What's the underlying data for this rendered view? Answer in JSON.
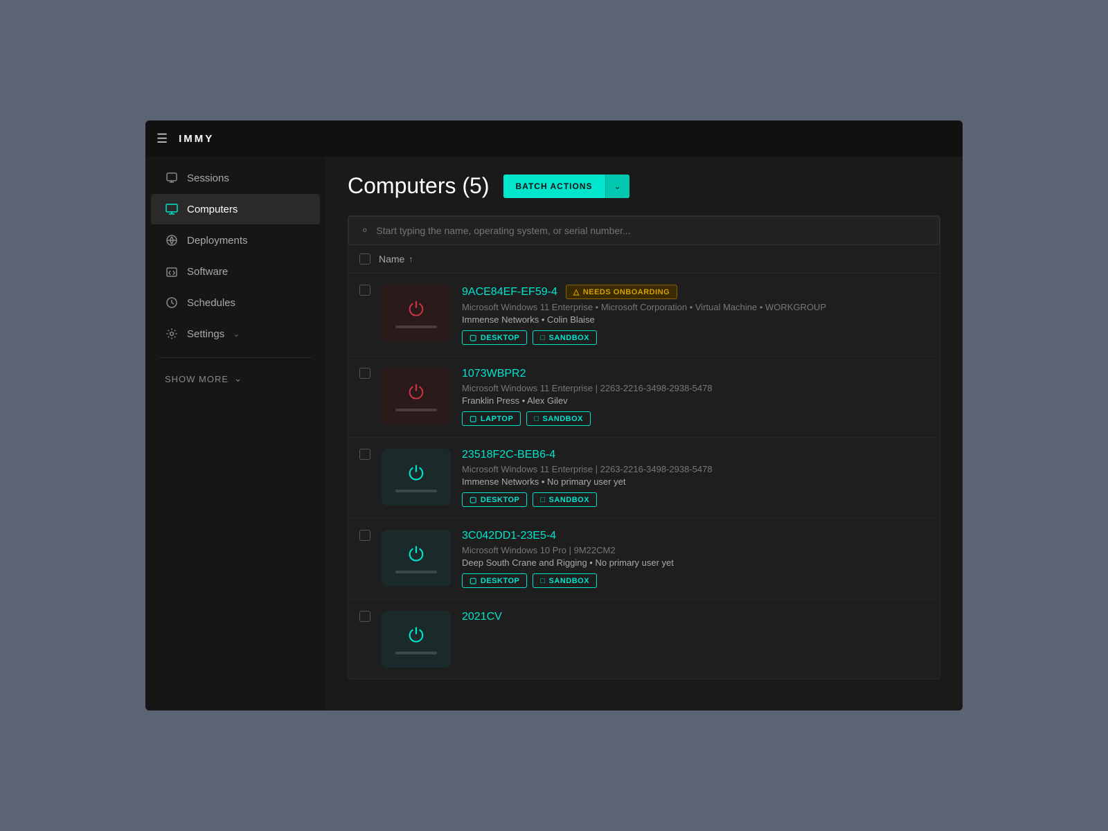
{
  "topbar": {
    "logo": "IMMY"
  },
  "sidebar": {
    "items": [
      {
        "id": "sessions",
        "label": "Sessions",
        "icon": "sessions-icon",
        "active": false
      },
      {
        "id": "computers",
        "label": "Computers",
        "icon": "computers-icon",
        "active": true
      },
      {
        "id": "deployments",
        "label": "Deployments",
        "icon": "deployments-icon",
        "active": false
      },
      {
        "id": "software",
        "label": "Software",
        "icon": "software-icon",
        "active": false
      },
      {
        "id": "schedules",
        "label": "Schedules",
        "icon": "schedules-icon",
        "active": false
      },
      {
        "id": "settings",
        "label": "Settings",
        "icon": "settings-icon",
        "active": false
      }
    ],
    "show_more": "SHOW MORE"
  },
  "page": {
    "title": "Computers (5)",
    "batch_actions_label": "BATCH ACTIONS",
    "search_placeholder": "Start typing the name, operating system, or serial number...",
    "table_header_name": "Name",
    "computers": [
      {
        "id": "comp-1",
        "name": "9ACE84EF-EF59-4",
        "badge": "NEEDS ONBOARDING",
        "meta": "Microsoft Windows 11 Enterprise  •  Microsoft Corporation  •  Virtual Machine  •  WORKGROUP",
        "user_info": "Immense Networks  •  Colin Blaise",
        "tags": [
          "DESKTOP",
          "SANDBOX"
        ],
        "power_color": "red",
        "bg": "red"
      },
      {
        "id": "comp-2",
        "name": "1073WBPR2",
        "badge": null,
        "meta": "Microsoft Windows 11 Enterprise | 2263-2216-3498-2938-5478",
        "user_info": "Franklin Press  •  Alex Gilev",
        "tags": [
          "LAPTOP",
          "SANDBOX"
        ],
        "power_color": "red",
        "bg": "red"
      },
      {
        "id": "comp-3",
        "name": "23518F2C-BEB6-4",
        "badge": null,
        "meta": "Microsoft Windows 11 Enterprise | 2263-2216-3498-2938-5478",
        "user_info": "Immense Networks  •  No primary user yet",
        "tags": [
          "DESKTOP",
          "SANDBOX"
        ],
        "power_color": "cyan",
        "bg": "green"
      },
      {
        "id": "comp-4",
        "name": "3C042DD1-23E5-4",
        "badge": null,
        "meta": "Microsoft Windows 10 Pro | 9M22CM2",
        "user_info": "Deep South Crane and Rigging  •  No primary user yet",
        "tags": [
          "DESKTOP",
          "SANDBOX"
        ],
        "power_color": "cyan",
        "bg": "green"
      },
      {
        "id": "comp-5",
        "name": "2021CV",
        "badge": null,
        "meta": "",
        "user_info": "",
        "tags": [],
        "power_color": "cyan",
        "bg": "green"
      }
    ]
  }
}
